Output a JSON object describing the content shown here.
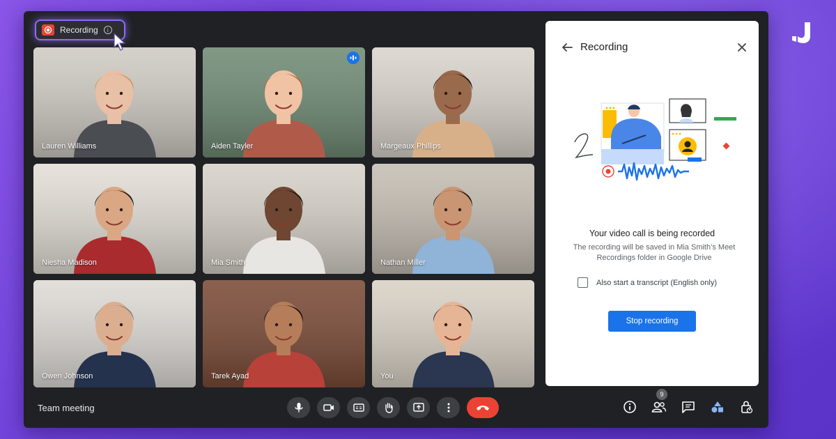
{
  "recording_chip": {
    "label": "Recording"
  },
  "participants": [
    {
      "name": "Lauren Williams",
      "skin": "#e8c0a6",
      "hair": "#c89a5c",
      "shirt": "#4a4d52",
      "bg": "#cfcac3",
      "speaking": false
    },
    {
      "name": "Aiden Tayler",
      "skin": "#f0c3a5",
      "hair": "#c06a38",
      "shirt": "#b05b4a",
      "bg": "#6f8a74",
      "speaking": true
    },
    {
      "name": "Margeaux Phillips",
      "skin": "#9a6a4c",
      "hair": "#1e1410",
      "shirt": "#d7b08a",
      "bg": "#d9d3cb",
      "speaking": false
    },
    {
      "name": "Niesha Madison",
      "skin": "#d9a784",
      "hair": "#1c1410",
      "shirt": "#a92b2e",
      "bg": "#e3ded6",
      "speaking": false
    },
    {
      "name": "Mia Smith",
      "skin": "#6e4632",
      "hair": "#1c120e",
      "shirt": "#e8e6e2",
      "bg": "#d6d1c8",
      "speaking": false
    },
    {
      "name": "Nathan Miller",
      "skin": "#c99572",
      "hair": "#241a14",
      "shirt": "#8fb4d8",
      "bg": "#c4bdb2",
      "speaking": false
    },
    {
      "name": "Owen Johnson",
      "skin": "#dcae90",
      "hair": "#8b8580",
      "shirt": "#24324e",
      "bg": "#dedbd6",
      "speaking": false
    },
    {
      "name": "Tarek Ayad",
      "skin": "#b57d5a",
      "hair": "#1c1512",
      "shirt": "#b8413a",
      "bg": "#7a4a36",
      "speaking": false
    },
    {
      "name": "You",
      "skin": "#e6b595",
      "hair": "#3a2418",
      "shirt": "#2b3650",
      "bg": "#d9d2c6",
      "speaking": false
    }
  ],
  "panel": {
    "title": "Recording",
    "heading": "Your video call is being recorded",
    "description": "The recording will be saved in Mia Smith’s Meet Recordings folder in Google Drive",
    "transcript_label": "Also start a transcript (English only)",
    "transcript_checked": false,
    "stop_button": "Stop recording"
  },
  "meeting": {
    "name": "Team meeting"
  },
  "people_count": "9",
  "colors": {
    "accent": "#1a73e8",
    "end_call": "#ea4335",
    "recording": "#ea4335",
    "brand_bg": "#6a3fd6"
  }
}
